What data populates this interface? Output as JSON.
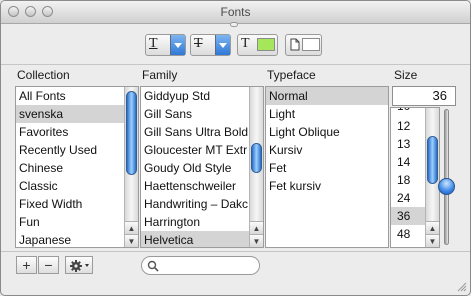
{
  "window": {
    "title": "Fonts"
  },
  "toolbar": {
    "underline_glyph": "T",
    "strikethrough_glyph": "T",
    "text_color_glyph": "T",
    "text_color": "#a6e65a",
    "document_color": "#ffffff"
  },
  "collection": {
    "header": "Collection",
    "items": [
      "All Fonts",
      "svenska",
      "Favorites",
      "Recently Used",
      "Chinese",
      "Classic",
      "Fixed Width",
      "Fun",
      "Japanese"
    ],
    "selected_index": 1
  },
  "family": {
    "header": "Family",
    "items": [
      "Giddyup Std",
      "Gill Sans",
      "Gill Sans Ultra Bold",
      "Gloucester MT Extr",
      "Goudy Old Style",
      "Haettenschweiler",
      "Handwriting – Dakc",
      "Harrington",
      "Helvetica"
    ],
    "selected_index": 8
  },
  "typeface": {
    "header": "Typeface",
    "items": [
      "Normal",
      "Light",
      "Light Oblique",
      "Kursiv",
      "Fet",
      "Fet kursiv"
    ],
    "selected_index": 0
  },
  "size": {
    "header": "Size",
    "current_value": "36",
    "partial_top": "10",
    "items": [
      "12",
      "13",
      "14",
      "18",
      "24",
      "36",
      "48"
    ],
    "selected_index": 5
  },
  "accent_color": "#3a86e6"
}
